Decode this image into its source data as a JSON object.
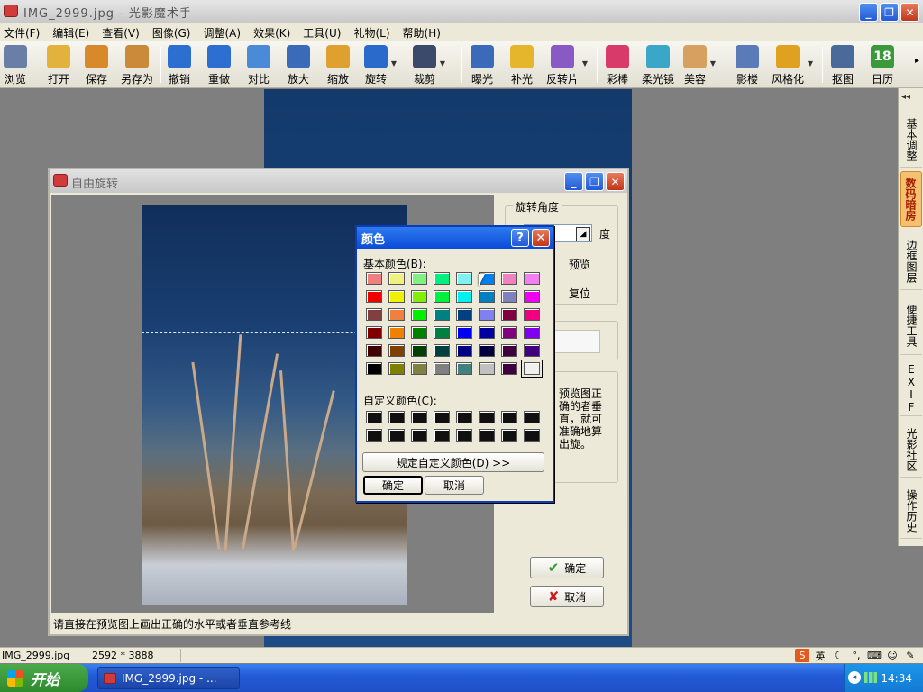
{
  "window": {
    "title": "IMG_2999.jpg - 光影魔术手",
    "buttons": {
      "minimize": "_",
      "maximize": "❐",
      "close": "✕"
    }
  },
  "menubar": {
    "items": [
      "文件(F)",
      "编辑(E)",
      "查看(V)",
      "图像(G)",
      "调整(A)",
      "效果(K)",
      "工具(U)",
      "礼物(L)",
      "帮助(H)"
    ]
  },
  "toolbar": {
    "items": [
      {
        "label": "浏览",
        "icon": "eye-icon",
        "color": "#6a7fa6"
      },
      {
        "label": "打开",
        "icon": "folder-icon",
        "color": "#e3b23c"
      },
      {
        "label": "保存",
        "icon": "floppy-icon",
        "color": "#d88a2a"
      },
      {
        "label": "另存为",
        "icon": "floppy-saveas-icon",
        "color": "#c98a3a"
      },
      {
        "label": "撤销",
        "icon": "undo-icon",
        "color": "#2d6fd1"
      },
      {
        "label": "重做",
        "icon": "redo-icon",
        "color": "#2d6fd1"
      },
      {
        "label": "对比",
        "icon": "compare-icon",
        "color": "#4a8ad6"
      },
      {
        "label": "放大",
        "icon": "zoom-in-icon",
        "color": "#3a6ab8"
      },
      {
        "label": "缩放",
        "icon": "resize-icon",
        "color": "#e0a030"
      },
      {
        "label": "旋转",
        "icon": "rotate-icon",
        "color": "#2a6acb"
      },
      {
        "label": "裁剪",
        "icon": "crop-icon",
        "color": "#3b4a6b"
      },
      {
        "label": "曝光",
        "icon": "exposure-icon",
        "color": "#3a6ab8"
      },
      {
        "label": "补光",
        "icon": "bulb-icon",
        "color": "#e5b52c"
      },
      {
        "label": "反转片",
        "icon": "film-icon",
        "color": "#8a5ac4"
      },
      {
        "label": "彩棒",
        "icon": "color-wand-icon",
        "color": "#d83a6a"
      },
      {
        "label": "柔光镜",
        "icon": "soft-lens-icon",
        "color": "#3aa6c8"
      },
      {
        "label": "美容",
        "icon": "face-icon",
        "color": "#d8a060"
      },
      {
        "label": "影楼",
        "icon": "studio-icon",
        "color": "#5a7ab8"
      },
      {
        "label": "风格化",
        "icon": "stylize-icon",
        "color": "#e0a020"
      },
      {
        "label": "抠图",
        "icon": "cutout-icon",
        "color": "#4a6a9a"
      },
      {
        "label": "日历",
        "icon": "calendar-icon",
        "color": "#3a9a3a",
        "glyph": "18"
      }
    ],
    "overflow": "▸"
  },
  "right_panel": {
    "tabs": [
      "基本调整",
      "数码暗房",
      "边框图层",
      "便捷工具",
      "EXIF",
      "光影社区",
      "操作历史"
    ],
    "active_index": 1,
    "collapse_arrow": "◂◂"
  },
  "rotate_dialog": {
    "title": "自由旋转",
    "group_title": "旋转角度",
    "degree_unit": "度",
    "preview_label": "预览",
    "reset_label": "复位",
    "hint_text": "预览图正确的者垂直，就可准确地算出旋。",
    "ok_label": "确定",
    "cancel_label": "取消",
    "status_text": "请直接在预览图上画出正确的水平或者垂直参考线"
  },
  "color_dialog": {
    "title": "颜色",
    "help_label": "?",
    "close_label": "✕",
    "basic_colors_label": "基本颜色(B):",
    "custom_colors_label": "自定义颜色(C):",
    "define_custom_label": "规定自定义颜色(D) >>",
    "ok_label": "确定",
    "cancel_label": "取消",
    "basic_colors": [
      "#f08080",
      "#f0f080",
      "#80f080",
      "#00f080",
      "#80f0f0",
      "#0080f0",
      "#f080c0",
      "#f080f0",
      "#f00000",
      "#f0f000",
      "#80f000",
      "#00f040",
      "#00f0f0",
      "#0080c0",
      "#8080c0",
      "#f000f0",
      "#804040",
      "#f08040",
      "#00f000",
      "#008080",
      "#004080",
      "#8080f0",
      "#800040",
      "#f00080",
      "#800000",
      "#f08000",
      "#008000",
      "#008040",
      "#0000f0",
      "#0000a0",
      "#800080",
      "#8000f0",
      "#400000",
      "#804000",
      "#004000",
      "#004040",
      "#000080",
      "#000040",
      "#400040",
      "#400080",
      "#000000",
      "#808000",
      "#808040",
      "#808080",
      "#408080",
      "#c0c0c0",
      "#400040",
      "#f0f0f0"
    ],
    "selected_index": 47,
    "custom_colors": [
      "#101010",
      "#101010",
      "#101010",
      "#101010",
      "#101010",
      "#101010",
      "#101010",
      "#101010",
      "#101010",
      "#101010",
      "#101010",
      "#101010",
      "#101010",
      "#101010",
      "#101010",
      "#101010"
    ]
  },
  "statusbar": {
    "filename": "IMG_2999.jpg",
    "dimensions": "2592 * 3888",
    "ime_label": "英"
  },
  "taskbar": {
    "start_label": "开始",
    "task_label": "IMG_2999.jpg - ...",
    "time": "14:34"
  }
}
